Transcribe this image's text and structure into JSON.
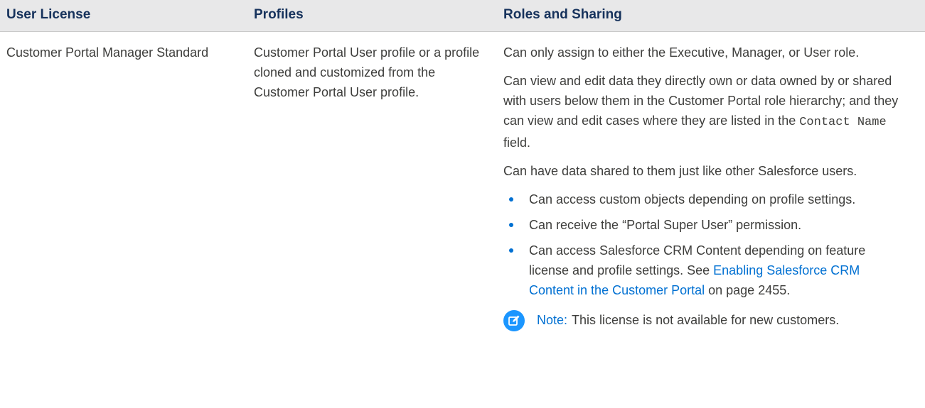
{
  "table": {
    "headers": {
      "user_license": "User License",
      "profiles": "Profiles",
      "roles_sharing": "Roles and Sharing"
    },
    "row": {
      "user_license": "Customer Portal Manager Standard",
      "profiles": "Customer Portal User profile or a profile cloned and customized from the Customer Portal User profile.",
      "roles": {
        "p1": "Can only assign to either the Executive, Manager, or User role.",
        "p2_before": "Can view and edit data they directly own or data owned by or shared with users below them in the Customer Portal role hierarchy; and they can view and edit cases where they are listed in the ",
        "p2_code": "Contact Name",
        "p2_after": " field.",
        "p3": "Can have data shared to them just like other Salesforce users.",
        "bullets": [
          "Can access custom objects depending on profile settings.",
          "Can receive the “Portal Super User” permission."
        ],
        "bullet3_before": "Can access Salesforce CRM Content depending on feature license and profile settings. See ",
        "bullet3_link": "Enabling Salesforce CRM Content in the Customer Portal",
        "bullet3_after": " on page 2455.",
        "note_label": "Note:",
        "note_text": "This license is not available for new customers."
      }
    }
  },
  "colors": {
    "header_bg": "#e8e8e9",
    "header_text": "#16325c",
    "body_text": "#3e3e3c",
    "link": "#0070d2",
    "note_icon": "#1b96ff"
  },
  "icons": {
    "note": "edit-note-icon"
  }
}
